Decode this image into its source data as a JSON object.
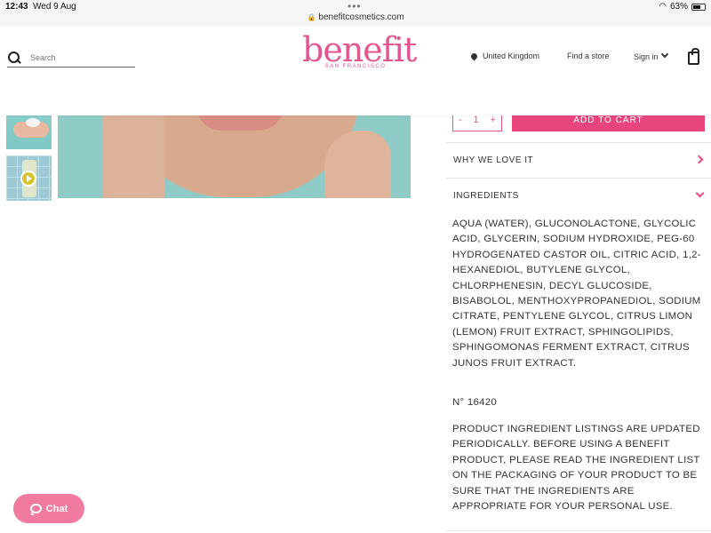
{
  "status_bar": {
    "time": "12:43",
    "date": "Wed 9 Aug",
    "url": "benefitcosmetics.com",
    "battery": "63%",
    "battery_level": 0.63
  },
  "header": {
    "search_placeholder": "Search",
    "logo_main": "benefit",
    "logo_sub": "SAN FRANCISCO",
    "country": "United Kingdom",
    "find_store": "Find a store",
    "sign_in": "Sign in"
  },
  "product": {
    "qty_minus": "-",
    "qty_value": "1",
    "qty_plus": "+",
    "add_to_cart": "ADD TO CART",
    "accordion": [
      {
        "label": "WHY WE LOVE IT"
      },
      {
        "label": "INGREDIENTS"
      }
    ],
    "ingredients_text": "AQUA (WATER), GLUCONOLACTONE, GLYCOLIC ACID, GLYCERIN, SODIUM HYDROXIDE, PEG-60 HYDROGENATED CASTOR OIL, CITRIC ACID, 1,2-HEXANEDIOL, BUTYLENE GLYCOL, CHLORPHENESIN, DECYL GLUCOSIDE, BISABOLOL, MENTHOXYPROPANEDIOL, SODIUM CITRATE, PENTYLENE GLYCOL, CITRUS LIMON (LEMON) FRUIT EXTRACT, SPHINGOLIPIDS, SPHINGOMONAS FERMENT EXTRACT, CITRUS JUNOS FRUIT EXTRACT.",
    "number": "N° 16420",
    "note": "PRODUCT INGREDIENT LISTINGS ARE UPDATED PERIODICALLY. BEFORE USING A BENEFIT PRODUCT, PLEASE READ THE INGREDIENT LIST ON THE PACKAGING OF YOUR PRODUCT TO BE SURE THAT THE INGREDIENTS ARE APPROPRIATE FOR YOUR PERSONAL USE."
  },
  "chat": {
    "label": "Chat"
  },
  "colors": {
    "brand_pink": "#e8457f",
    "logo_pink": "#e45594",
    "chat_pink": "#f07b9f"
  }
}
